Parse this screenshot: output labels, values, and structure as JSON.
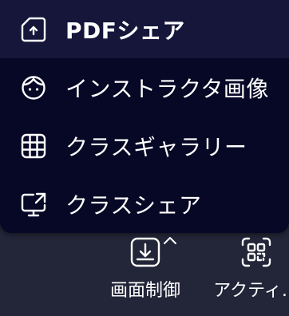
{
  "menu": {
    "items": [
      {
        "label": "PDFシェア",
        "icon": "pdf-share-icon",
        "active": true
      },
      {
        "label": "インストラクタ画像",
        "icon": "instructor-face-icon",
        "active": false
      },
      {
        "label": "クラスギャラリー",
        "icon": "grid-gallery-icon",
        "active": false
      },
      {
        "label": "クラスシェア",
        "icon": "screen-share-icon",
        "active": false
      }
    ]
  },
  "toolbar": {
    "screen_control_label": "画面制御",
    "activity_label": "アクティ…",
    "screen_control_icon": "download-tray-icon",
    "activity_icon": "qr-scan-icon",
    "caret_icon": "caret-up-icon"
  },
  "colors": {
    "page_bg": "#232538",
    "menu_bg": "#070726",
    "active_item_bg": "#15163a",
    "text": "#ffffff"
  }
}
